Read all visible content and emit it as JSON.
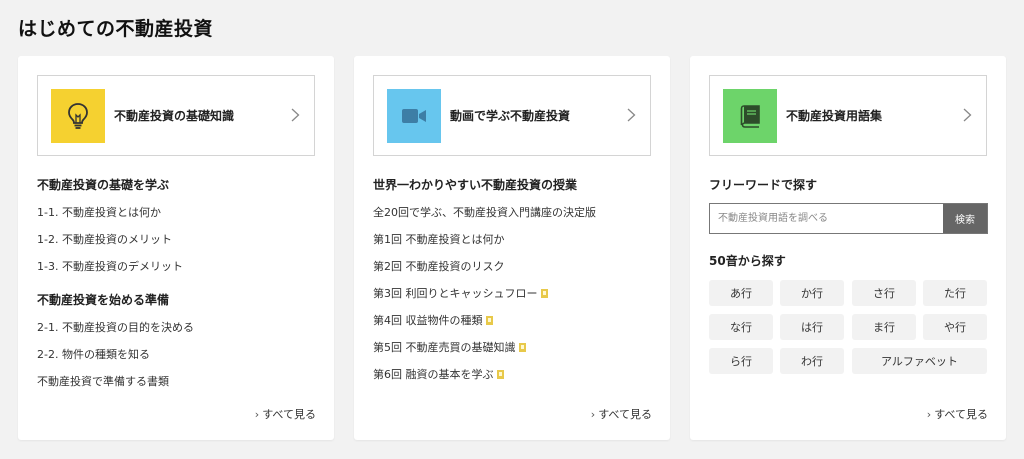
{
  "page": {
    "title": "はじめての不動産投資"
  },
  "cards": [
    {
      "hero": {
        "label": "不動産投資の基礎知識",
        "icon": "lightbulb-icon",
        "color": "#f5d130"
      },
      "sections": [
        {
          "title": "不動産投資の基礎を学ぶ",
          "items": [
            "1-1. 不動産投資とは何か",
            "1-2. 不動産投資のメリット",
            "1-3. 不動産投資のデメリット"
          ]
        },
        {
          "title": "不動産投資を始める準備",
          "items": [
            "2-1. 不動産投資の目的を決める",
            "2-2. 物件の種類を知る",
            "不動産投資で準備する書類"
          ]
        }
      ],
      "see_all": "すべて見る"
    },
    {
      "hero": {
        "label": "動画で学ぶ不動産投資",
        "icon": "video-camera-icon",
        "color": "#67c6ee"
      },
      "section_title": "世界一わかりやすい不動産投資の授業",
      "items": [
        {
          "label": "全20回で学ぶ、不動産投資入門講座の決定版",
          "mark": false
        },
        {
          "label": "第1回 不動産投資とは何か",
          "mark": false
        },
        {
          "label": "第2回 不動産投資のリスク",
          "mark": false
        },
        {
          "label": "第3回 利回りとキャッシュフロー",
          "mark": true
        },
        {
          "label": "第4回 収益物件の種類",
          "mark": true
        },
        {
          "label": "第5回 不動産売買の基礎知識",
          "mark": true
        },
        {
          "label": "第6回 融資の基本を学ぶ",
          "mark": true
        }
      ],
      "see_all": "すべて見る"
    },
    {
      "hero": {
        "label": "不動産投資用語集",
        "icon": "book-icon",
        "color": "#6dd46a"
      },
      "freeword_title": "フリーワードで探す",
      "search": {
        "placeholder": "不動産投資用語を調べる",
        "button": "検索"
      },
      "kana_title": "50音から探す",
      "kana": [
        "あ行",
        "か行",
        "さ行",
        "た行",
        "な行",
        "は行",
        "ま行",
        "や行",
        "ら行",
        "わ行",
        "アルファベット"
      ],
      "see_all": "すべて見る"
    }
  ]
}
